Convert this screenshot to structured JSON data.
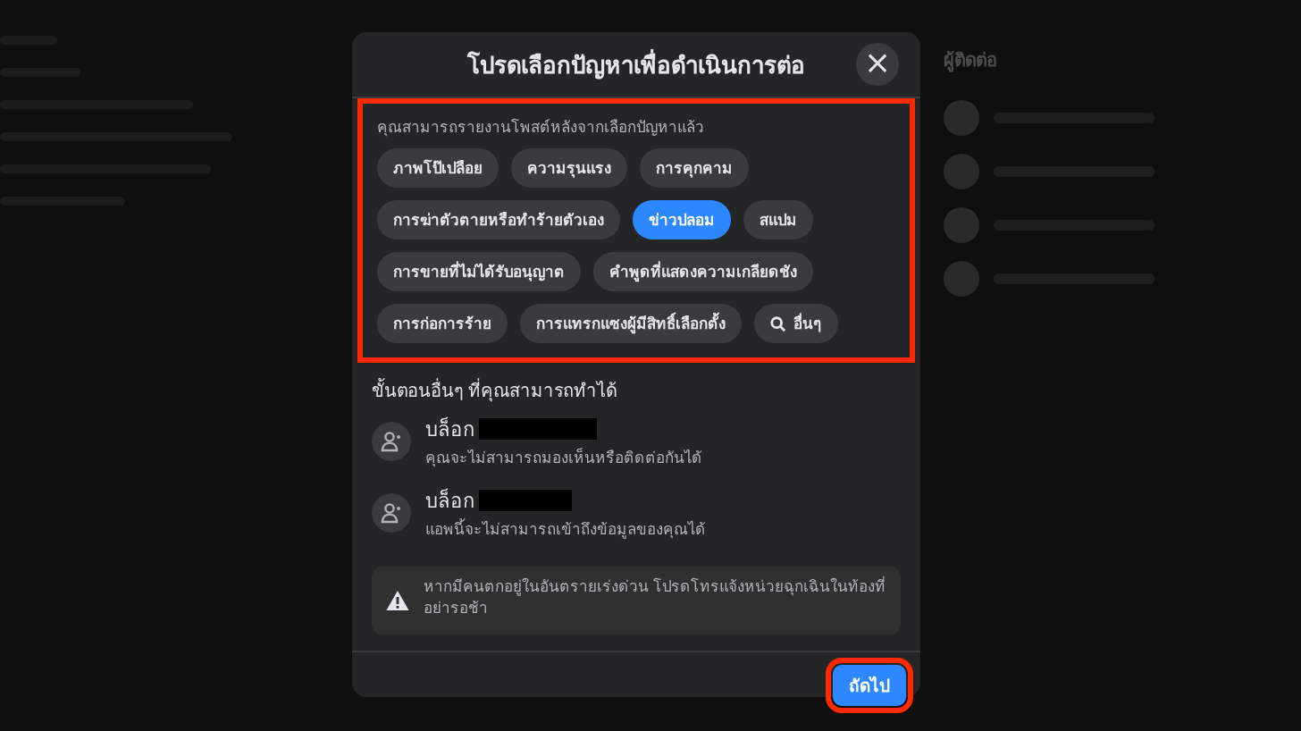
{
  "dialog": {
    "title": "โปรดเลือกปัญหาเพื่อดำเนินการต่อ",
    "close_label": "×",
    "reasons": {
      "hint": "คุณสามารถรายงานโพสต์หลังจากเลือกปัญหาแล้ว",
      "highlighted": true,
      "options": [
        {
          "label": "ภาพโป๊เปลือย",
          "selected": false,
          "kind": "chip"
        },
        {
          "label": "ความรุนแรง",
          "selected": false,
          "kind": "chip"
        },
        {
          "label": "การคุกคาม",
          "selected": false,
          "kind": "chip"
        },
        {
          "label": "การฆ่าตัวตายหรือทำร้ายตัวเอง",
          "selected": false,
          "kind": "chip"
        },
        {
          "label": "ข่าวปลอม",
          "selected": true,
          "kind": "chip"
        },
        {
          "label": "สแปม",
          "selected": false,
          "kind": "chip"
        },
        {
          "label": "การขายที่ไม่ได้รับอนุญาต",
          "selected": false,
          "kind": "chip"
        },
        {
          "label": "คำพูดที่แสดงความเกลียดชัง",
          "selected": false,
          "kind": "chip"
        },
        {
          "label": "การก่อการร้าย",
          "selected": false,
          "kind": "chip"
        },
        {
          "label": "การแทรกแซงผู้มีสิทธิ์เลือกตั้ง",
          "selected": false,
          "kind": "chip"
        },
        {
          "label": "อื่นๆ",
          "selected": false,
          "kind": "search"
        }
      ]
    },
    "other_steps": {
      "heading": "ขั้นตอนอื่นๆ ที่คุณสามารถทำได้",
      "items": [
        {
          "action": "บล็อก",
          "description": "คุณจะไม่สามารถมองเห็นหรือติดต่อกันได้"
        },
        {
          "action": "บล็อก",
          "description": "แอพนี้จะไม่สามารถเข้าถึงข้อมูลของคุณได้"
        }
      ]
    },
    "notice": "หากมีคนตกอยู่ในอันตรายเร่งด่วน โปรดโทรแจ้งหน่วยฉุกเฉินในท้องที่ อย่ารอช้า",
    "next_button": {
      "label": "ถัดไป",
      "highlighted": true
    }
  },
  "contacts": {
    "heading": "ผู้ติดต่อ"
  }
}
